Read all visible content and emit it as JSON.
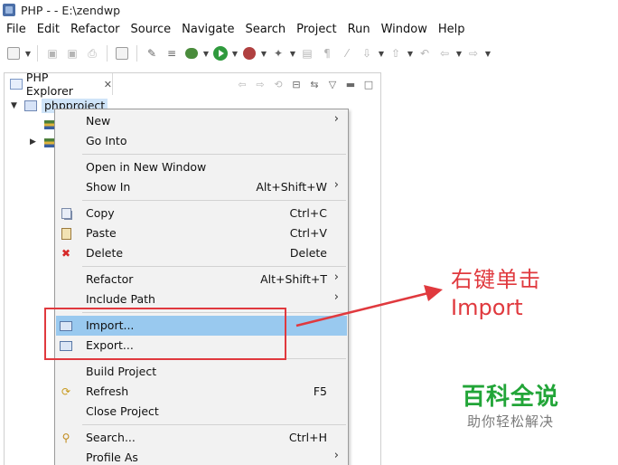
{
  "window": {
    "title": "PHP -  - E:\\zendwp"
  },
  "menubar": [
    "File",
    "Edit",
    "Refactor",
    "Source",
    "Navigate",
    "Search",
    "Project",
    "Run",
    "Window",
    "Help"
  ],
  "explorer": {
    "tab_label": "PHP Explorer",
    "project_name": "phpproject"
  },
  "context_menu": {
    "new": {
      "label": "New"
    },
    "go_into": {
      "label": "Go Into"
    },
    "open_new_window": {
      "label": "Open in New Window"
    },
    "show_in": {
      "label": "Show In",
      "shortcut": "Alt+Shift+W"
    },
    "copy": {
      "label": "Copy",
      "shortcut": "Ctrl+C"
    },
    "paste": {
      "label": "Paste",
      "shortcut": "Ctrl+V"
    },
    "delete": {
      "label": "Delete",
      "shortcut": "Delete"
    },
    "refactor": {
      "label": "Refactor",
      "shortcut": "Alt+Shift+T"
    },
    "include_path": {
      "label": "Include Path"
    },
    "import": {
      "label": "Import..."
    },
    "export": {
      "label": "Export..."
    },
    "build_project": {
      "label": "Build Project"
    },
    "refresh": {
      "label": "Refresh",
      "shortcut": "F5"
    },
    "close_project": {
      "label": "Close Project"
    },
    "search": {
      "label": "Search...",
      "shortcut": "Ctrl+H"
    },
    "profile_as": {
      "label": "Profile As"
    },
    "submenu_glyph": "›"
  },
  "annotation": {
    "line1": "右键单击",
    "line2": "Import",
    "color": "#e0393e"
  },
  "watermark": {
    "brand": "百科全说",
    "slogan": "助你轻松解决",
    "color": "#22a538"
  }
}
